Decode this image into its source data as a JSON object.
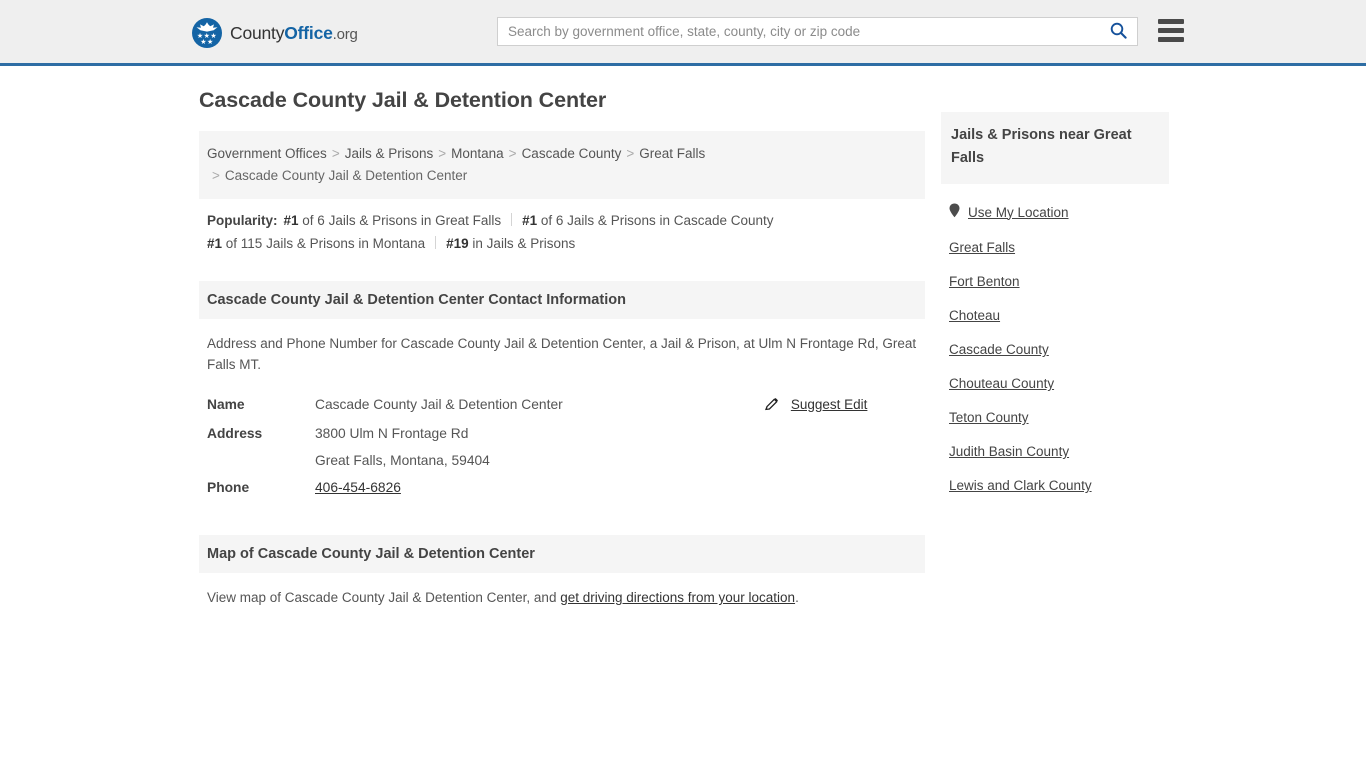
{
  "header": {
    "logo": {
      "icon": "eagle-seal-icon",
      "text_part1": "County",
      "text_part2": "Office",
      "text_part3": ".org",
      "brand_color": "#1464a5"
    },
    "search": {
      "placeholder": "Search by government office, state, county, city or zip code",
      "value": "",
      "search_icon": "search-icon"
    },
    "menu_icon": "hamburger-menu-icon",
    "background_color": "#efefef",
    "border_color": "#2e6da4"
  },
  "main": {
    "page_title": "Cascade County Jail & Detention Center",
    "breadcrumb": {
      "separator": ">",
      "items": [
        "Government Offices",
        "Jails & Prisons",
        "Montana",
        "Cascade County",
        "Great Falls"
      ],
      "current": "Cascade County Jail & Detention Center"
    },
    "popularity": {
      "label": "Popularity:",
      "items": [
        {
          "rank": "#1",
          "text": " of 6 Jails & Prisons in Great Falls"
        },
        {
          "rank": "#1",
          "text": " of 6 Jails & Prisons in Cascade County"
        },
        {
          "rank": "#1",
          "text": " of 115 Jails & Prisons in Montana"
        },
        {
          "rank": "#19",
          "text": " in Jails & Prisons"
        }
      ]
    },
    "contact": {
      "heading": "Cascade County Jail & Detention Center Contact Information",
      "description": "Address and Phone Number for Cascade County Jail & Detention Center, a Jail & Prison, at Ulm N Frontage Rd, Great Falls MT.",
      "rows": [
        {
          "label": "Name",
          "value": "Cascade County Jail & Detention Center",
          "is_link": false
        },
        {
          "label": "Address",
          "value": "3800 Ulm N Frontage Rd",
          "is_link": false
        },
        {
          "label": "",
          "value": "Great Falls, Montana, 59404",
          "is_link": false
        },
        {
          "label": "Phone",
          "value": "406-454-6826",
          "is_link": true
        }
      ],
      "suggest_edit": {
        "label": "Suggest Edit",
        "icon": "edit-pencil-icon"
      }
    },
    "map": {
      "heading": "Map of Cascade County Jail & Detention Center",
      "description_prefix": "View map of Cascade County Jail & Detention Center, and ",
      "description_link": "get driving directions from your location",
      "description_suffix": "."
    }
  },
  "sidebar": {
    "heading": "Jails & Prisons near Great Falls",
    "use_my_location": {
      "label": "Use My Location",
      "icon": "map-pin-icon"
    },
    "links": [
      "Great Falls",
      "Fort Benton",
      "Choteau",
      "Cascade County",
      "Chouteau County",
      "Teton County",
      "Judith Basin County",
      "Lewis and Clark County"
    ]
  }
}
